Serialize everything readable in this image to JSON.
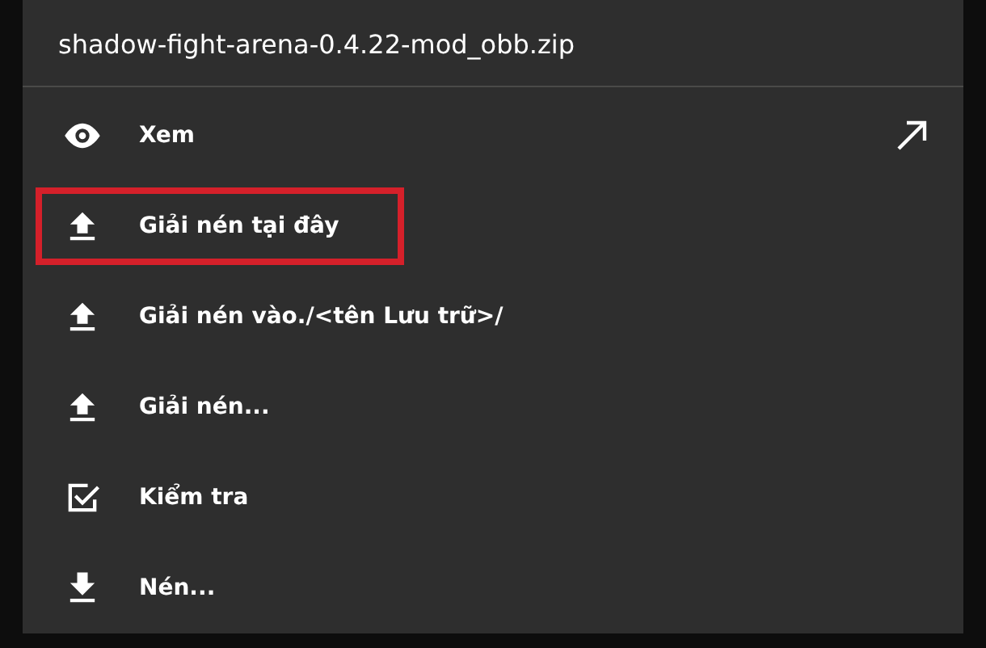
{
  "menu": {
    "title": "shadow-fight-arena-0.4.22-mod_obb.zip",
    "items": [
      {
        "label": "Xem",
        "kind": "eye",
        "highlighted": false,
        "open_arrow": true
      },
      {
        "label": "Giải nén tại đây",
        "kind": "upload",
        "highlighted": true,
        "open_arrow": false
      },
      {
        "label": "Giải nén vào./<tên Lưu trữ>/",
        "kind": "upload",
        "highlighted": false,
        "open_arrow": false
      },
      {
        "label": "Giải nén...",
        "kind": "upload",
        "highlighted": false,
        "open_arrow": false
      },
      {
        "label": "Kiểm tra",
        "kind": "check",
        "highlighted": false,
        "open_arrow": false
      },
      {
        "label": "Nén...",
        "kind": "download",
        "highlighted": false,
        "open_arrow": false
      }
    ]
  }
}
